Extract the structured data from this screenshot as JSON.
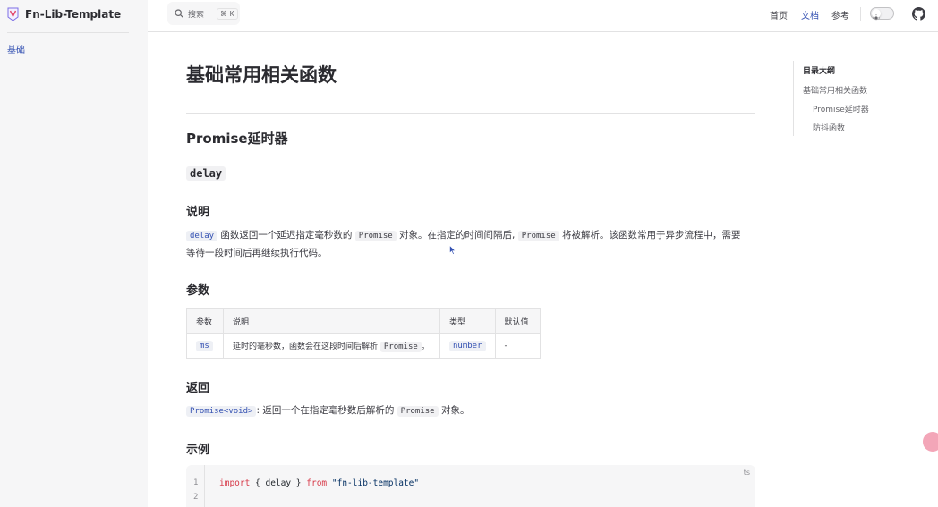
{
  "brand": {
    "name": "Fn-Lib-Template"
  },
  "sidebar": {
    "items": [
      {
        "label": "基础"
      }
    ]
  },
  "search": {
    "label": "搜索",
    "shortcut": "⌘ K"
  },
  "nav": {
    "home": "首页",
    "docs": "文档",
    "reference": "参考"
  },
  "doc": {
    "title": "基础常用相关函数",
    "section_title": "Promise延时器",
    "function_name": "delay",
    "desc_heading": "说明",
    "desc": {
      "code1": "delay",
      "t1": " 函数返回一个延迟指定毫秒数的 ",
      "code2": "Promise",
      "t2": " 对象。在指定的时间间隔后, ",
      "code3": "Promise",
      "t3": " 将被解析。该函数常用于异步流程中，需要",
      "line2": "等待一段时间后再继续执行代码。"
    },
    "params_heading": "参数",
    "params_table": {
      "headers": [
        "参数",
        "说明",
        "类型",
        "默认值"
      ],
      "row": {
        "name": "ms",
        "desc": "延时的毫秒数，函数会在这段时间后解析 ",
        "desc_code": "Promise",
        "desc_end": "。",
        "type": "number",
        "default": "-"
      }
    },
    "returns_heading": "返回",
    "returns": {
      "code1": "Promise<void>",
      "t1": ": 返回一个在指定毫秒数后解析的 ",
      "code2": "Promise",
      "t2": " 对象。"
    },
    "example_heading": "示例",
    "code_example": {
      "lang": "ts",
      "line_numbers": [
        "1",
        "2"
      ],
      "line1": {
        "kw1": "import",
        "mid": " { delay } ",
        "kw2": "from",
        "str": "\"fn-lib-template\""
      }
    }
  },
  "toc": {
    "title": "目录大纲",
    "items": [
      {
        "label": "基础常用相关函数"
      },
      {
        "label": "Promise延时器"
      },
      {
        "label": "防抖函数"
      }
    ]
  },
  "colors": {
    "accent": "#3451b2",
    "text": "#3c3c43",
    "border": "#e2e2e3",
    "sidebar_bg": "#f6f6f7"
  },
  "icons": {
    "brand": "vitepress-logo-icon",
    "search": "search-icon",
    "theme": "sun-icon",
    "repo": "github-icon"
  }
}
